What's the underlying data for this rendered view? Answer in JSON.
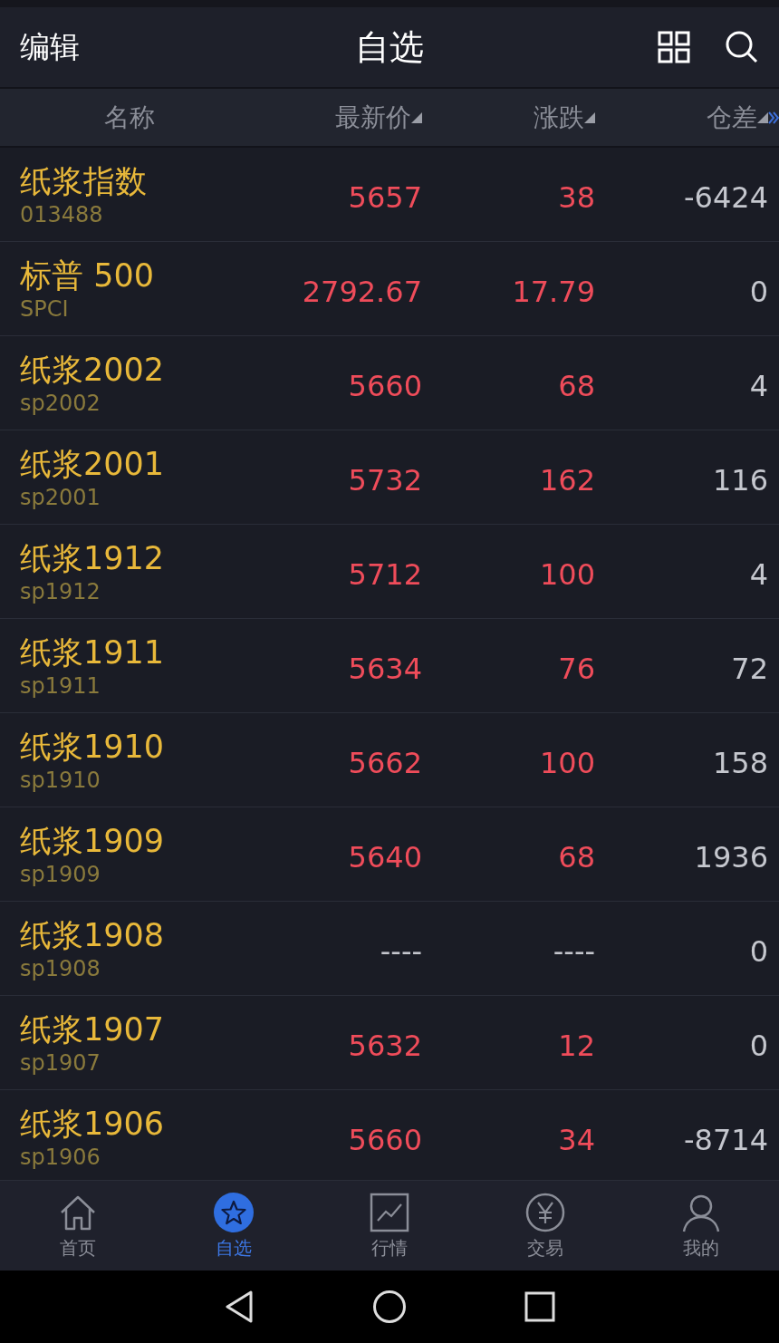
{
  "header": {
    "edit": "编辑",
    "title": "自选"
  },
  "columns": [
    {
      "label": "名称",
      "sortable": false
    },
    {
      "label": "最新价",
      "sortable": true
    },
    {
      "label": "涨跌",
      "sortable": true
    },
    {
      "label": "仓差",
      "sortable": true
    }
  ],
  "rows": [
    {
      "name": "纸浆指数",
      "code": "013488",
      "price": "5657",
      "change": "38",
      "oi_change": "-6424",
      "quoted": true
    },
    {
      "name": "标普 500",
      "code": "SPCI",
      "price": "2792.67",
      "change": "17.79",
      "oi_change": "0",
      "quoted": true
    },
    {
      "name": "纸浆2002",
      "code": "sp2002",
      "price": "5660",
      "change": "68",
      "oi_change": "4",
      "quoted": true
    },
    {
      "name": "纸浆2001",
      "code": "sp2001",
      "price": "5732",
      "change": "162",
      "oi_change": "116",
      "quoted": true
    },
    {
      "name": "纸浆1912",
      "code": "sp1912",
      "price": "5712",
      "change": "100",
      "oi_change": "4",
      "quoted": true
    },
    {
      "name": "纸浆1911",
      "code": "sp1911",
      "price": "5634",
      "change": "76",
      "oi_change": "72",
      "quoted": true
    },
    {
      "name": "纸浆1910",
      "code": "sp1910",
      "price": "5662",
      "change": "100",
      "oi_change": "158",
      "quoted": true
    },
    {
      "name": "纸浆1909",
      "code": "sp1909",
      "price": "5640",
      "change": "68",
      "oi_change": "1936",
      "quoted": true
    },
    {
      "name": "纸浆1908",
      "code": "sp1908",
      "price": "----",
      "change": "----",
      "oi_change": "0",
      "quoted": false
    },
    {
      "name": "纸浆1907",
      "code": "sp1907",
      "price": "5632",
      "change": "12",
      "oi_change": "0",
      "quoted": true
    },
    {
      "name": "纸浆1906",
      "code": "sp1906",
      "price": "5660",
      "change": "34",
      "oi_change": "-8714",
      "quoted": true
    }
  ],
  "tabs": [
    {
      "label": "首页",
      "kind": "home",
      "selected": false
    },
    {
      "label": "自选",
      "kind": "star",
      "selected": true
    },
    {
      "label": "行情",
      "kind": "chart",
      "selected": false
    },
    {
      "label": "交易",
      "kind": "yen",
      "selected": false
    },
    {
      "label": "我的",
      "kind": "person",
      "selected": false
    }
  ]
}
